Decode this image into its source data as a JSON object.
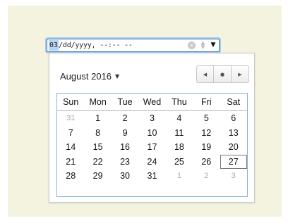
{
  "input": {
    "month_segment": "03",
    "rest_text": "/dd/yyyy, --:-- --",
    "clear_symbol": "×",
    "spin_up": "▲",
    "spin_down": "▼",
    "dropdown_symbol": "▼"
  },
  "picker": {
    "month_label": "August 2016",
    "month_dropdown_symbol": "▼",
    "nav": {
      "prev": "◀",
      "today": "●",
      "next": "▶"
    },
    "weekdays": [
      "Sun",
      "Mon",
      "Tue",
      "Wed",
      "Thu",
      "Fri",
      "Sat"
    ],
    "weeks": [
      [
        "31",
        "1",
        "2",
        "3",
        "4",
        "5",
        "6"
      ],
      [
        "7",
        "8",
        "9",
        "10",
        "11",
        "12",
        "13"
      ],
      [
        "14",
        "15",
        "16",
        "17",
        "18",
        "19",
        "20"
      ],
      [
        "21",
        "22",
        "23",
        "24",
        "25",
        "26",
        "27"
      ],
      [
        "28",
        "29",
        "30",
        "31",
        "1",
        "2",
        "3"
      ]
    ],
    "today": "27"
  },
  "colors": {
    "page_background": "#f3f3e0",
    "focus_border": "#3b82c4",
    "selected_segment": "#b9d3f3",
    "grid_border": "#8ab4dc",
    "muted_text": "#aaaaaa"
  }
}
